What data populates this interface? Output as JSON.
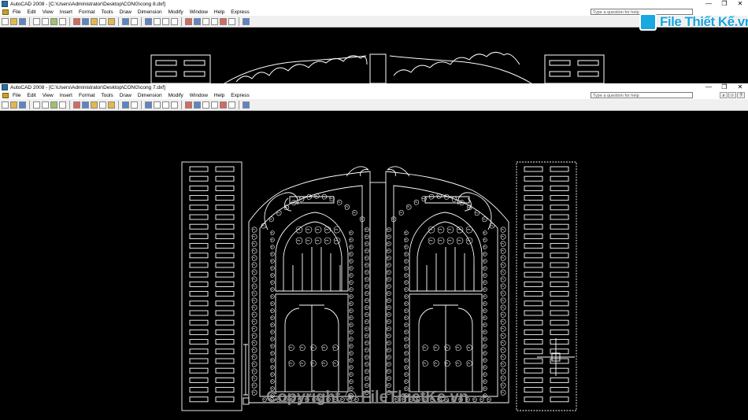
{
  "window_back": {
    "title": "AutoCAD 2008 - [C:\\Users\\Administrator\\Desktop\\CONG\\cong 8.dxf]",
    "help_placeholder": "Type a question for help"
  },
  "window_front": {
    "title": "AutoCAD 2008 - [C:\\Users\\Administrator\\Desktop\\CONG\\cong 7.dxf]",
    "help_placeholder": "Type a question for help"
  },
  "menus": [
    "File",
    "Edit",
    "View",
    "Insert",
    "Format",
    "Tools",
    "Draw",
    "Dimension",
    "Modify",
    "Window",
    "Help",
    "Express"
  ],
  "window_controls": [
    "—",
    "❐",
    "✕"
  ],
  "brand": {
    "text": "File Thiết Kế.vn"
  },
  "watermark": {
    "text": "Copyright © FileThietKe.vn"
  },
  "colors": {
    "canvas": "#000000",
    "lines": "#ffffff",
    "brand": "#17a3de"
  },
  "icons": [
    "autocad-app-icon",
    "document-icon",
    "toolbar-icons"
  ]
}
